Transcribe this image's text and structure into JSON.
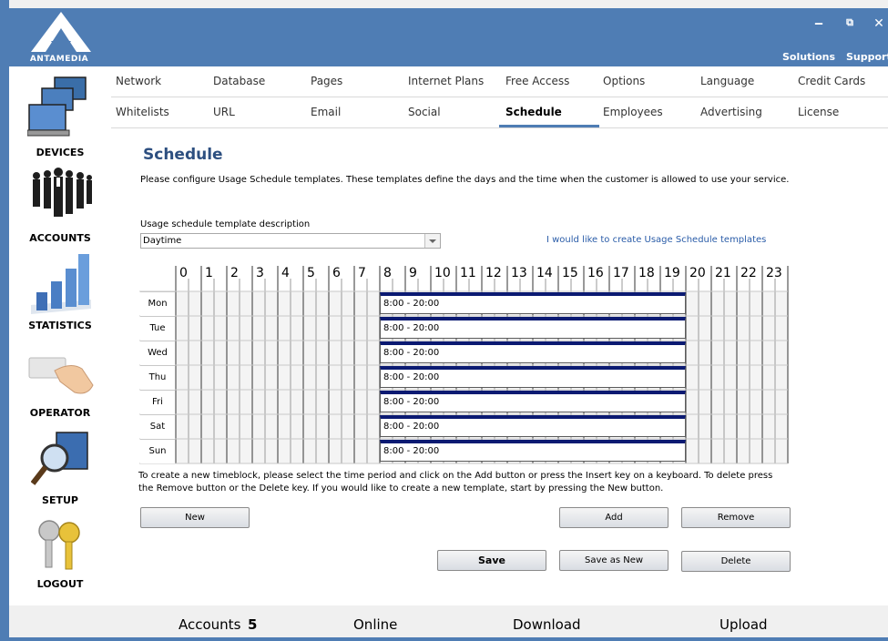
{
  "app": {
    "logo_text": "ANTAMEDIA",
    "top_links": [
      "Solutions",
      "Support"
    ],
    "window_buttons": [
      "minimize-icon",
      "restore-icon",
      "close-icon"
    ]
  },
  "sidebar": {
    "items": [
      {
        "label": "DEVICES",
        "icon": "computers-icon"
      },
      {
        "label": "ACCOUNTS",
        "icon": "people-icon"
      },
      {
        "label": "STATISTICS",
        "icon": "bar-chart-icon"
      },
      {
        "label": "OPERATOR",
        "icon": "card-hand-icon"
      },
      {
        "label": "SETUP",
        "icon": "magnifier-monitor-icon"
      },
      {
        "label": "LOGOUT",
        "icon": "keys-icon"
      }
    ]
  },
  "tabs": {
    "row1": [
      "Network",
      "Database",
      "Pages",
      "Internet Plans",
      "Free Access",
      "Options",
      "Language",
      "Credit Cards"
    ],
    "row2": [
      "Whitelists",
      "URL",
      "Email",
      "Social",
      "Schedule",
      "Employees",
      "Advertising",
      "License"
    ],
    "active": "Schedule"
  },
  "main": {
    "title": "Schedule",
    "description": "Please configure Usage Schedule templates. These templates define the days and the time when the customer is allowed to use your service.",
    "template_label": "Usage schedule template description",
    "template_value": "Daytime",
    "create_link": "I would like to create Usage Schedule templates",
    "hours": [
      "0",
      "1",
      "2",
      "3",
      "4",
      "5",
      "6",
      "7",
      "8",
      "9",
      "10",
      "11",
      "12",
      "13",
      "14",
      "15",
      "16",
      "17",
      "18",
      "19",
      "20",
      "21",
      "22",
      "23"
    ],
    "days": [
      {
        "day": "Mon",
        "block": "8:00 - 20:00"
      },
      {
        "day": "Tue",
        "block": "8:00 - 20:00"
      },
      {
        "day": "Wed",
        "block": "8:00 - 20:00"
      },
      {
        "day": "Thu",
        "block": "8:00 - 20:00"
      },
      {
        "day": "Fri",
        "block": "8:00 - 20:00"
      },
      {
        "day": "Sat",
        "block": "8:00 - 20:00"
      },
      {
        "day": "Sun",
        "block": "8:00 - 20:00"
      }
    ],
    "block_start_hour": 8,
    "block_end_hour": 20,
    "instructions": "To create a new timeblock, please select the time period and click on the Add button or press the Insert key on a keyboard. To delete press the Remove button or the Delete key. If you would like to create a new template, start by pressing the New button.",
    "buttons": {
      "new": "New",
      "add": "Add",
      "remove": "Remove",
      "save": "Save",
      "save_as_new": "Save as New",
      "delete": "Delete"
    }
  },
  "status": {
    "accounts_label": "Accounts",
    "accounts_value": "5",
    "online_label": "Online",
    "download_label": "Download",
    "upload_label": "Upload"
  },
  "colors": {
    "frame": "#4f7db4",
    "title": "#2d4f80",
    "block_bar": "#0b1a72",
    "link": "#2a5ca8"
  }
}
